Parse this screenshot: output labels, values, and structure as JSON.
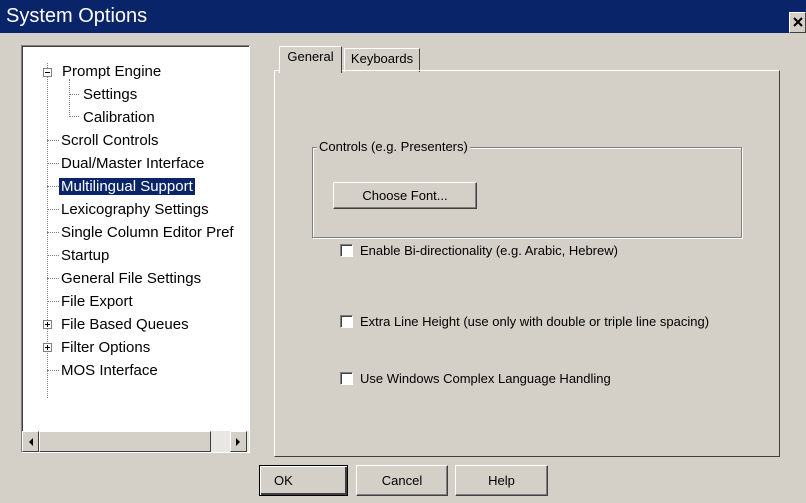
{
  "window": {
    "title": "System Options",
    "close_glyph": "✕"
  },
  "tree": {
    "items": [
      {
        "label": "Prompt Engine",
        "expander": "minus"
      },
      {
        "label": "Settings"
      },
      {
        "label": "Calibration"
      },
      {
        "label": "Scroll Controls"
      },
      {
        "label": "Dual/Master Interface"
      },
      {
        "label": "Multilingual Support",
        "selected": true
      },
      {
        "label": "Lexicography Settings"
      },
      {
        "label": "Single Column Editor Pref"
      },
      {
        "label": "Startup"
      },
      {
        "label": "General File Settings"
      },
      {
        "label": "File Export"
      },
      {
        "label": "File Based Queues",
        "expander": "plus"
      },
      {
        "label": "Filter Options",
        "expander": "plus"
      },
      {
        "label": "MOS Interface"
      }
    ]
  },
  "tabs": [
    {
      "label": "General",
      "active": true
    },
    {
      "label": "Keyboards"
    }
  ],
  "general": {
    "controls_group_label": "Controls (e.g. Presenters)",
    "choose_font_label": "Choose Font...",
    "checkboxes": [
      {
        "label": "Enable Bi-directionality (e.g. Arabic, Hebrew)",
        "checked": false
      },
      {
        "label": "Extra Line Height (use only with double or triple line spacing)",
        "checked": false
      },
      {
        "label": "Use Windows Complex Language Handling",
        "checked": false
      }
    ]
  },
  "footer": {
    "ok_label": "OK",
    "cancel_label": "Cancel",
    "help_label": "Help"
  },
  "colors": {
    "titlebar": "#0a246a",
    "selection": "#0a246a",
    "face": "#d4d0c8"
  }
}
